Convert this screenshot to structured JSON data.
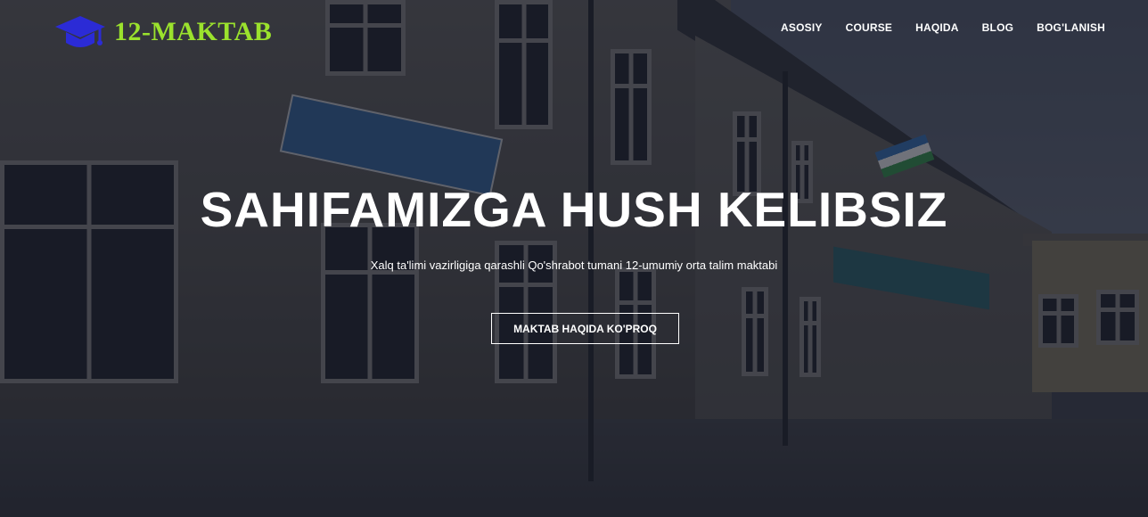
{
  "brand": {
    "name": "12-MAKTAB",
    "icon": "graduation-cap-icon",
    "name_color": "#9be22d",
    "icon_color": "#2b2bd6"
  },
  "nav": {
    "items": [
      {
        "label": "ASOSIY"
      },
      {
        "label": "COURSE"
      },
      {
        "label": "HAQIDA"
      },
      {
        "label": "BLOG"
      },
      {
        "label": "BOG'LANISH"
      }
    ]
  },
  "hero": {
    "title": "SAHIFAMIZGA HUSH KELIBSIZ",
    "subtitle": "Xalq ta'limi vazirligiga qarashli Qo'shrabot tumani 12-umumiy orta talim maktabi",
    "button_label": "MAKTAB HAQIDA KO'PROQ",
    "background": "school-building-photo"
  }
}
